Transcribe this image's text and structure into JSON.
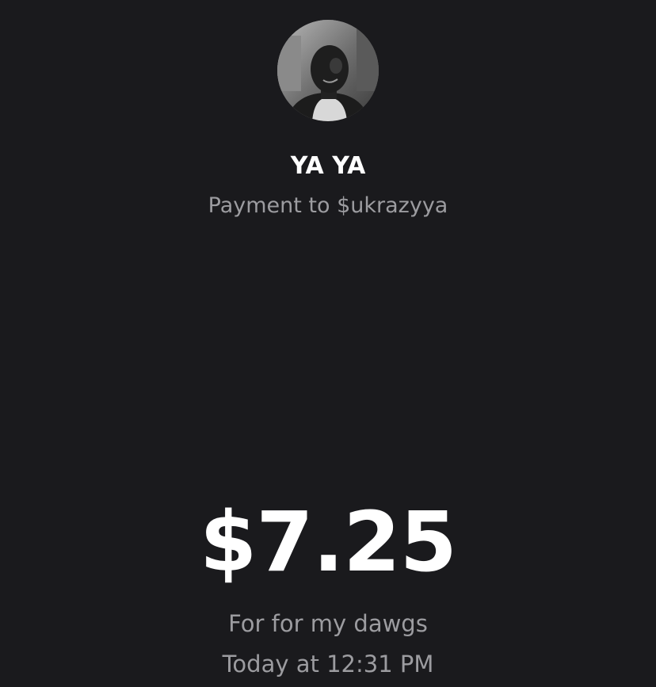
{
  "recipient": {
    "name": "YA YA",
    "subtitle": "Payment to $ukrazyya",
    "avatar_icon": "profile-photo"
  },
  "payment": {
    "amount": "$7.25",
    "note": "For for my dawgs",
    "timestamp": "Today at 12:31 PM"
  },
  "colors": {
    "background": "#1a1a1d",
    "primary_text": "#ffffff",
    "secondary_text": "#9c9ca0"
  }
}
